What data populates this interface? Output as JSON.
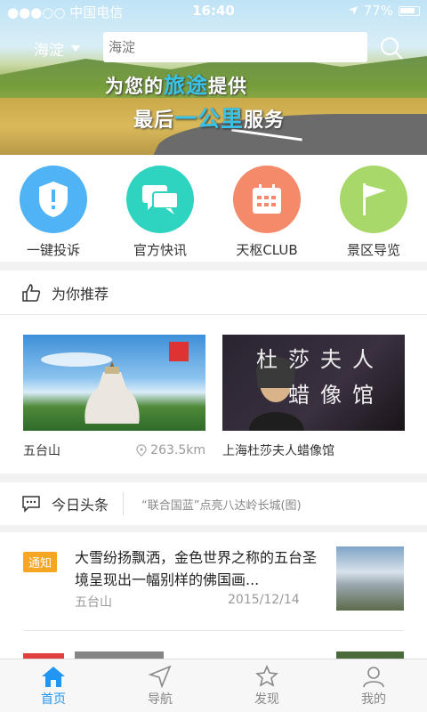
{
  "status": {
    "carrier": "●●●○○ 中国电信",
    "time": "16:40",
    "battery": "77%"
  },
  "header": {
    "city": "海淀",
    "search_placeholder": "海淀"
  },
  "banner": {
    "line1_a": "为您的",
    "line1_hl": "旅途",
    "line1_b": "提供",
    "line2_a": "最后",
    "line2_hl": "一公里",
    "line2_b": "服务"
  },
  "actions": [
    {
      "label": "一键投诉",
      "color": "#4fb3f6"
    },
    {
      "label": "官方快讯",
      "color": "#2ed4c0"
    },
    {
      "label": "天枢CLUB",
      "color": "#f58a6a"
    },
    {
      "label": "景区导览",
      "color": "#a8d86a"
    }
  ],
  "recommend": {
    "title": "为你推荐",
    "cards": [
      {
        "name": "五台山",
        "distance": "263.5km"
      },
      {
        "name": "上海杜莎夫人蜡像馆",
        "img_text": "杜莎夫人蜡像馆"
      }
    ]
  },
  "headlines": {
    "title": "今日头条",
    "ticker": "“联合国蓝”点亮八达岭长城(图)",
    "items": [
      {
        "tag": "通知",
        "title": "大雪纷扬飘洒，金色世界之称的五台圣境呈现出一幅别样的佛国画...",
        "place": "五台山",
        "date": "2015/12/14"
      }
    ]
  },
  "tabs": [
    {
      "label": "首页"
    },
    {
      "label": "导航"
    },
    {
      "label": "发现"
    },
    {
      "label": "我的"
    }
  ]
}
